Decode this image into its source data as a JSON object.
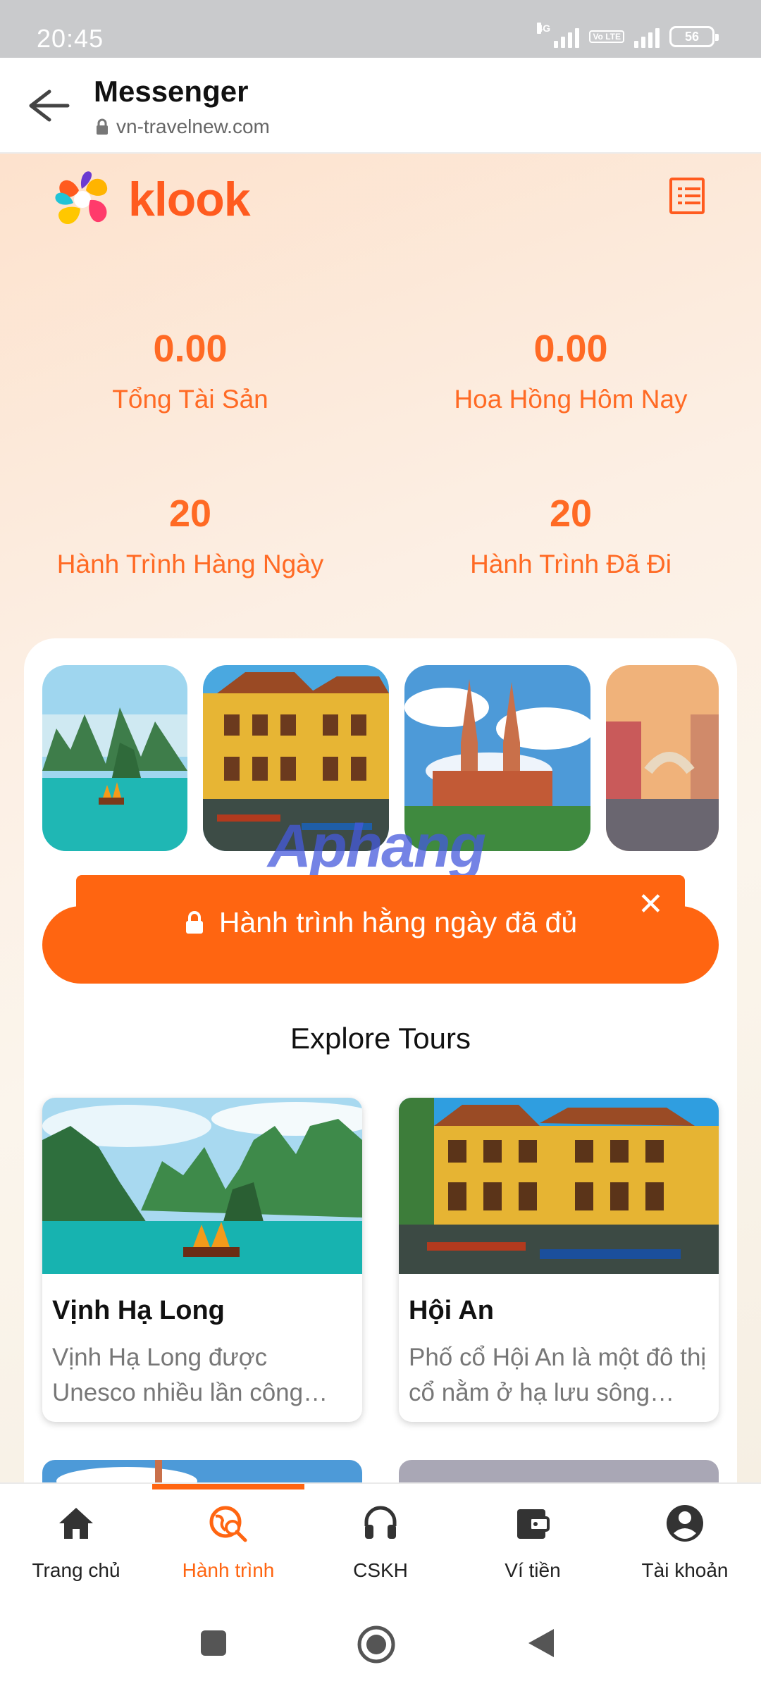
{
  "status_bar": {
    "time": "20:45",
    "network_1": "4G",
    "network_2": "Vo LTE",
    "battery": "56"
  },
  "header": {
    "title": "Messenger",
    "url": "vn-travelnew.com"
  },
  "brand": {
    "name": "klook",
    "accent_color": "#ff5b1f"
  },
  "stats": [
    {
      "value": "0.00",
      "label": "Tổng Tài Sản"
    },
    {
      "value": "0.00",
      "label": "Hoa Hồng Hôm Nay"
    },
    {
      "value": "20",
      "label": "Hành Trình Hàng Ngày"
    },
    {
      "value": "20",
      "label": "Hành Trình Đã Đi"
    }
  ],
  "carousel": [
    {
      "name": "ha-long-bay"
    },
    {
      "name": "hoi-an"
    },
    {
      "name": "saigon-cathedral"
    },
    {
      "name": "canal-town"
    }
  ],
  "watermark": "Aphang",
  "notice": {
    "text": "Hành trình hằng ngày đã đủ",
    "close": "✕"
  },
  "section_title": "Explore Tours",
  "tours": [
    {
      "name": "Vịnh Hạ Long",
      "desc": "Vịnh Hạ Long được Unesco nhiều lần công…"
    },
    {
      "name": "Hội An",
      "desc": "Phố cổ Hội An là một đô thị cổ nằm ở hạ lưu sông…"
    }
  ],
  "bottom_nav": [
    {
      "label": "Trang chủ",
      "icon": "home-icon"
    },
    {
      "label": "Hành trình",
      "icon": "journey-search-icon",
      "active": true
    },
    {
      "label": "CSKH",
      "icon": "headset-icon"
    },
    {
      "label": "Ví tiền",
      "icon": "wallet-icon"
    },
    {
      "label": "Tài khoản",
      "icon": "account-icon"
    }
  ]
}
